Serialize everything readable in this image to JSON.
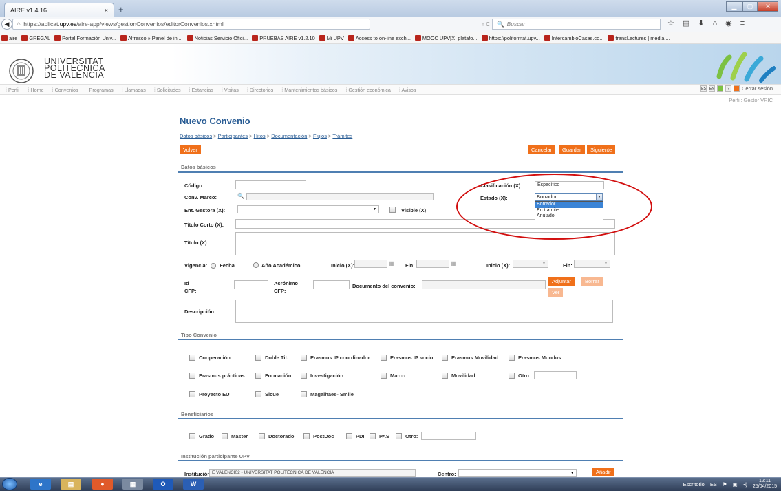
{
  "browser": {
    "tab_title": "AIRE v1.4.16",
    "tab_close": "×",
    "new_tab": "+",
    "url_prefix": "https://aplicat.",
    "url_host": "upv.es",
    "url_path": "/aire-app/views/gestionConvenios/editorConvenios.xhtml",
    "url_right": "▿ C",
    "search_placeholder": "Buscar",
    "bookmarks": [
      "aire",
      "GREGAL",
      "Portal Formación Univ...",
      "Alfresco » Panel de ini...",
      "Noticias Servicio Ofici...",
      "PRUEBAS AIRE v1.2.10",
      "Mi UPV",
      "Access to on-line exch...",
      "MOOC UPV[X] platafo...",
      "https://poliformat.upv...",
      "IntercambioCasas.co...",
      "transLectures | media ..."
    ]
  },
  "site": {
    "uni_line1": "UNIVERSITAT",
    "uni_line2": "POLITÈCNICA",
    "uni_line3": "DE VALÈNCIA",
    "menu": [
      "Perfil",
      "Home",
      "Convenios",
      "Programas",
      "Llamadas",
      "Solicitudes",
      "Estancias",
      "Visitas",
      "Directorios",
      "Mantenimientos básicos",
      "Gestión económica",
      "Avisos"
    ],
    "cerrar": "Cerrar sesión",
    "perfil": "Perfil: Gestor VRIC"
  },
  "page": {
    "title": "Nuevo Convenio",
    "crumbs": [
      "Datos básicos",
      "Participantes",
      "Hitos",
      "Documentación",
      "Flujos",
      "Trámites"
    ],
    "crumb_sep": " > ",
    "btn_volver": "Volver",
    "btn_cancelar": "Cancelar",
    "btn_guardar": "Guardar",
    "btn_siguiente": "Siguiente",
    "sec_datos": "Datos básicos",
    "codigo": "Código:",
    "conv_marco": "Conv. Marco:",
    "ent_gestora": "Ent. Gestora (X):",
    "visible": "Visible (X)",
    "titulo_corto": "Título Corto (X):",
    "titulo": "Título (X):",
    "clasificacion": "Clasificación (X):",
    "clasificacion_value": "Específico",
    "estado": "Estado (X):",
    "estado_value": "Borrador",
    "estado_options": [
      "Borrador",
      "En trámite",
      "Anulado"
    ],
    "vigencia": "Vigencia:",
    "fecha": "Fecha",
    "anio": "Año Académico",
    "inicio": "Inicio (X):",
    "fin": "Fin:",
    "inicio2": "Inicio (X):",
    "fin2": "Fin:",
    "id_cfp_1": "Id",
    "id_cfp_2": "CFP:",
    "acronimo_1": "Acrónimo",
    "acronimo_2": "CFP:",
    "documento": "Documento  del convenio:",
    "btn_adjuntar": "Adjuntar",
    "btn_borrar": "Borrar",
    "btn_ver": "Ver",
    "descripcion": "Descripción :",
    "sec_tipo": "Tipo Convenio",
    "tipo_row1": [
      "Cooperación",
      "Doble Tit.",
      "Erasmus IP coordinador",
      "Erasmus IP socio",
      "Erasmus Movilidad",
      "Erasmus Mundus"
    ],
    "tipo_row2": [
      "Erasmus prácticas",
      "Formación",
      "Investigación",
      "Marco",
      "Movilidad",
      "Otro:"
    ],
    "tipo_row3": [
      "Proyecto EU",
      "Sicue",
      "Magalhaes- Smile"
    ],
    "sec_benef": "Beneficiarios",
    "benef": [
      "Grado",
      "Master",
      "Doctorado",
      "PostDoc",
      "PDI",
      "PAS",
      "Otro:"
    ],
    "sec_inst": "Institución participante UPV",
    "institucion": "Institución:",
    "institucion_value": "E VALENCI02 - UNIVERSITAT POLITÈCNICA DE VALÈNCIA",
    "centro": "Centro:",
    "btn_anadir": "Añadir"
  },
  "taskbar": {
    "escritorio": "Escritorio",
    "lang": "ES",
    "time": "12:11",
    "date": "25/04/2015"
  },
  "colors": {
    "accent": "#f0701a",
    "link": "#2a5d95",
    "annotation": "#d20f0f"
  }
}
